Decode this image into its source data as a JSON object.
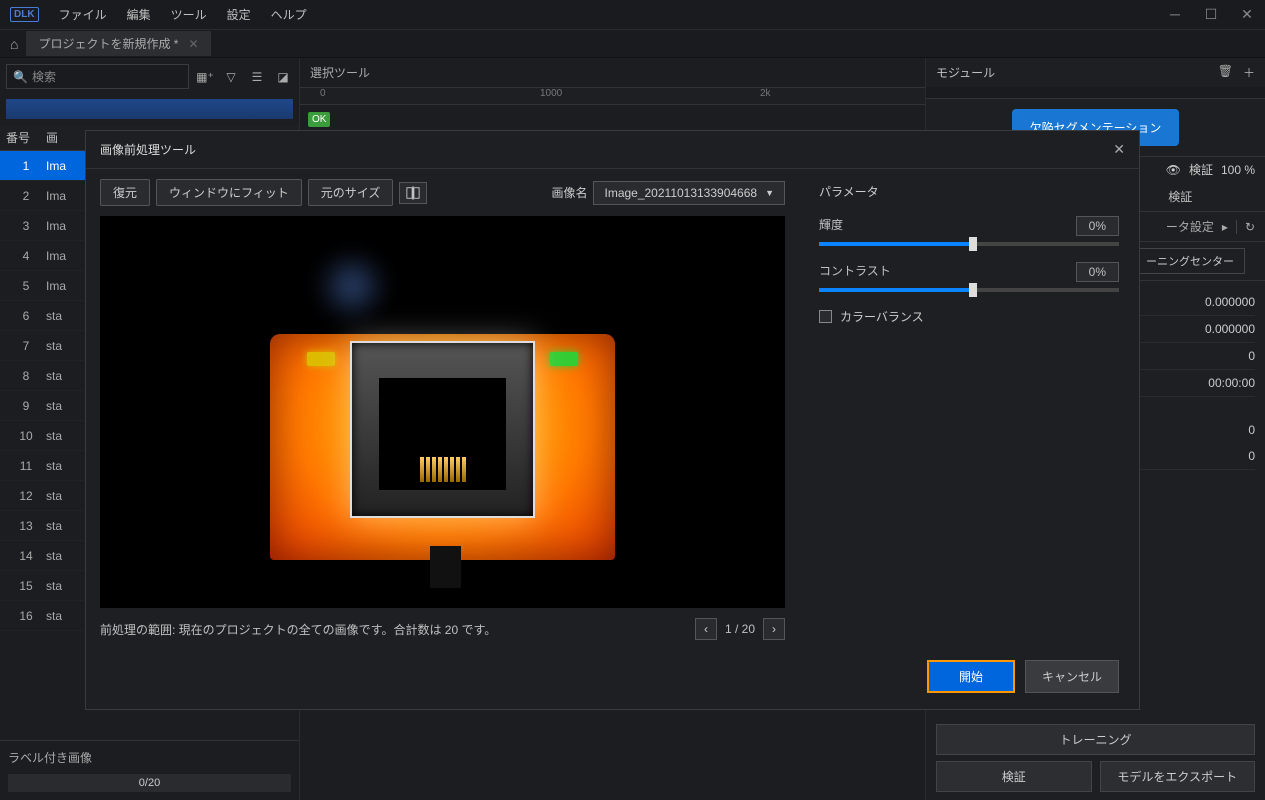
{
  "menubar": {
    "logo": "DLK",
    "file": "ファイル",
    "edit": "編集",
    "tool": "ツール",
    "settings": "設定",
    "help": "ヘルプ"
  },
  "tab": {
    "title": "プロジェクトを新規作成 *"
  },
  "search": {
    "placeholder": "検索"
  },
  "list": {
    "header_num": "番号",
    "header_img": "画",
    "rows": [
      {
        "n": "1",
        "name": "Ima"
      },
      {
        "n": "2",
        "name": "Ima"
      },
      {
        "n": "3",
        "name": "Ima"
      },
      {
        "n": "4",
        "name": "Ima"
      },
      {
        "n": "5",
        "name": "Ima"
      },
      {
        "n": "6",
        "name": "sta"
      },
      {
        "n": "7",
        "name": "sta"
      },
      {
        "n": "8",
        "name": "sta"
      },
      {
        "n": "9",
        "name": "sta"
      },
      {
        "n": "10",
        "name": "sta"
      },
      {
        "n": "11",
        "name": "sta"
      },
      {
        "n": "12",
        "name": "sta"
      },
      {
        "n": "13",
        "name": "sta"
      },
      {
        "n": "14",
        "name": "sta"
      },
      {
        "n": "15",
        "name": "sta"
      },
      {
        "n": "16",
        "name": "sta"
      }
    ],
    "labeled_title": "ラベル付き画像",
    "progress": "0/20"
  },
  "center": {
    "ok": "OK",
    "select_tool": "選択ツール",
    "ruler": {
      "zero": "0",
      "k1": "1000",
      "k2": "2k"
    }
  },
  "right": {
    "module": "モジュール",
    "seg_btn": "欠陥セグメンテーション",
    "verify": "検証",
    "percent": "100 %",
    "data_settings": "ータ設定",
    "caret": "▸",
    "training_center": "ーニングセンター",
    "vals": {
      "v1": "0.000000",
      "v2": "0.000000",
      "v3": "0",
      "v4": "00:00:00",
      "v5": "0",
      "v6": "0"
    },
    "btn_train": "トレーニング",
    "btn_verify": "検証",
    "btn_export": "モデルをエクスポート"
  },
  "modal": {
    "title": "画像前処理ツール",
    "restore": "復元",
    "fit": "ウィンドウにフィット",
    "orig": "元のサイズ",
    "image_name_label": "画像名",
    "image_name": "Image_20211013133904668",
    "scope": "前処理の範囲:  現在のプロジェクトの全ての画像です。合計数は  20  です。",
    "page": "1 / 20",
    "params_title": "パラメータ",
    "brightness": "輝度",
    "brightness_val": "0%",
    "contrast": "コントラスト",
    "contrast_val": "0%",
    "color_balance": "カラーバランス",
    "start": "開始",
    "cancel": "キャンセル"
  }
}
